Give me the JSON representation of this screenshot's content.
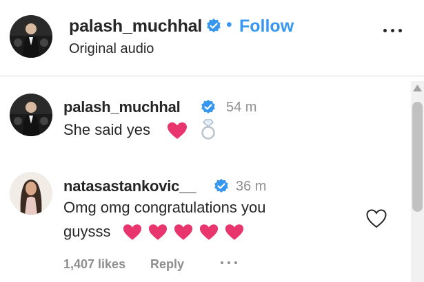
{
  "header": {
    "username": "palash_muchhal",
    "dot": "•",
    "follow_label": "Follow",
    "subtitle": "Original audio"
  },
  "comments": [
    {
      "username": "palash_muchhal",
      "time": "54 m",
      "text": "She said yes",
      "emojis": [
        "red-heart",
        "ring"
      ]
    },
    {
      "username": "natasastankovic__",
      "time": "36 m",
      "text_line1": "Omg omg congratulations you",
      "text_line2": "guysss",
      "emojis": [
        "heart",
        "heart",
        "heart",
        "heart",
        "heart"
      ],
      "likes": "1,407 likes",
      "reply_label": "Reply"
    }
  ],
  "colors": {
    "verified": "#3797ef",
    "follow": "#3797ef",
    "heart": "#e8356d",
    "muted": "#8e8e8e"
  }
}
